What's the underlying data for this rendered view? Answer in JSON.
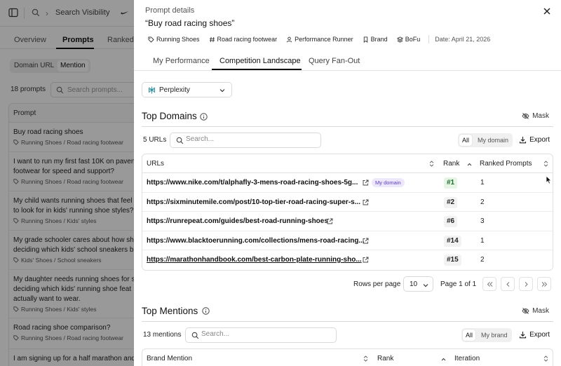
{
  "background": {
    "breadcrumb": {
      "section": "Search Visibility"
    },
    "tabs": [
      "Overview",
      "Prompts",
      "Ranked"
    ],
    "active_tab": "Prompts",
    "segment": [
      "Domain URL",
      "Mention"
    ],
    "prompt_count": "18 prompts",
    "search_placeholder": "Search prompts...",
    "list_header": "Prompt",
    "prompts": [
      {
        "text": "Buy road racing shoes",
        "tag": "Running Shoes / Road racing footwear"
      },
      {
        "text": "I want to run my first fast 10K on paven footwear for speed and support?",
        "tag": "Running Shoes / Road racing footwear"
      },
      {
        "text": "My child wants running shoes that feel to look for in kids' running shoe styles?",
        "tag": "Running Shoes / Kids' styles"
      },
      {
        "text": "My grade schooler cares about how sh deciding which kids' school sneakers b",
        "tag": "Kids' Shoes / School sneakers"
      },
      {
        "text": "My daughter needs running shoes for s deciding which kids' running shoe feat actually want to wear.",
        "tag": "Running Shoes / Kids' styles"
      },
      {
        "text": "Road racing shoe comparison?",
        "tag": "Running Shoes / Road racing footwear"
      },
      {
        "text": "I am signing up for a half marathon and",
        "tag": ""
      }
    ]
  },
  "panel": {
    "label": "Prompt details",
    "title": "“Buy road racing shoes”",
    "chips": [
      {
        "icon": "tag-icon",
        "label": "Running Shoes"
      },
      {
        "icon": "hash-icon",
        "label": "Road racing footwear"
      },
      {
        "icon": "user-icon",
        "label": "Performance Runner"
      },
      {
        "icon": "bookmark-icon",
        "label": "Brand"
      },
      {
        "icon": "layers-icon",
        "label": "BoFu"
      }
    ],
    "date": "Date: April 21, 2026",
    "tabs": [
      "My Performance",
      "Competition Landscape",
      "Query Fan-Out"
    ],
    "active_tab": "Competition Landscape",
    "engine": "Perplexity",
    "top_domains": {
      "title": "Top Domains",
      "mask_label": "Mask",
      "count": "5 URLs",
      "search_placeholder": "Search...",
      "filter": [
        "All",
        "My domain"
      ],
      "export_label": "Export",
      "headers": [
        "URLs",
        "Rank",
        "Ranked Prompts"
      ],
      "rows": [
        {
          "url": "https://www.nike.com/t/alphafly-3-mens-road-racing-shoes-5g...",
          "badge": "My domain",
          "rank": "#1",
          "ranked_prompts": "1"
        },
        {
          "url": "https://sixminutemile.com/post/10-top-tier-road-racing-super-s...",
          "badge": "",
          "rank": "#2",
          "ranked_prompts": "2"
        },
        {
          "url": "https://runrepeat.com/guides/best-road-running-shoes",
          "badge": "",
          "rank": "#6",
          "ranked_prompts": "3"
        },
        {
          "url": "https://www.blacktoerunning.com/collections/mens-road-racing...",
          "badge": "",
          "rank": "#14",
          "ranked_prompts": "1"
        },
        {
          "url": "https://marathonhandbook.com/best-carbon-plate-running-sho...",
          "badge": "",
          "rank": "#15",
          "ranked_prompts": "2"
        }
      ],
      "rows_per_page_label": "Rows per page",
      "rows_per_page": "10",
      "page_info": "Page 1 of 1"
    },
    "top_mentions": {
      "title": "Top Mentions",
      "mask_label": "Mask",
      "count": "13 mentions",
      "search_placeholder": "Search...",
      "filter": [
        "All",
        "My brand"
      ],
      "export_label": "Export",
      "headers": [
        "Brand Mention",
        "Rank",
        "Iteration"
      ]
    }
  }
}
